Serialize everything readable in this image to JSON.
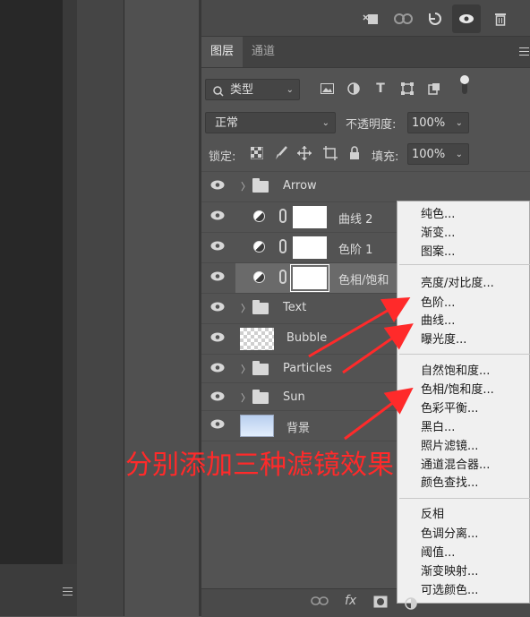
{
  "tabs": {
    "layers": "图层",
    "channels": "通道"
  },
  "filter": {
    "kind_label": "类型"
  },
  "blend": {
    "mode": "正常",
    "opacity_label": "不透明度:",
    "opacity_value": "100%"
  },
  "lock": {
    "label": "锁定:",
    "fill_label": "填充:",
    "fill_value": "100%"
  },
  "layers": [
    {
      "name": "Arrow",
      "type": "group"
    },
    {
      "name": "曲线 2",
      "type": "adjustment"
    },
    {
      "name": "色阶 1",
      "type": "adjustment"
    },
    {
      "name": "色相/饱和",
      "type": "adjustment",
      "selected": true
    },
    {
      "name": "Text",
      "type": "group"
    },
    {
      "name": "Bubble",
      "type": "pixel"
    },
    {
      "name": "Particles",
      "type": "group"
    },
    {
      "name": "Sun",
      "type": "group"
    },
    {
      "name": "背景",
      "type": "background"
    }
  ],
  "menu": {
    "group1": [
      "纯色...",
      "渐变...",
      "图案..."
    ],
    "group2": [
      "亮度/对比度...",
      "色阶...",
      "曲线...",
      "曝光度..."
    ],
    "group3": [
      "自然饱和度...",
      "色相/饱和度...",
      "色彩平衡...",
      "黑白...",
      "照片滤镜...",
      "通道混合器...",
      "颜色查找..."
    ],
    "group4": [
      "反相",
      "色调分离...",
      "阈值...",
      "渐变映射...",
      "可选颜色..."
    ]
  },
  "annotation": "分别添加三种滤镜效果",
  "bottom": {
    "fx_label": "fx"
  },
  "colors": {
    "annotation": "#ff2a2a",
    "menu_bg": "#f0f0f0",
    "panel_bg": "#535353"
  },
  "icons": [
    "eye-icon",
    "trash-icon",
    "rotate-icon",
    "link-icon",
    "folder-icon",
    "adjustment-icon",
    "lock-icon",
    "move-icon",
    "brush-icon",
    "panel-menu-icon"
  ]
}
